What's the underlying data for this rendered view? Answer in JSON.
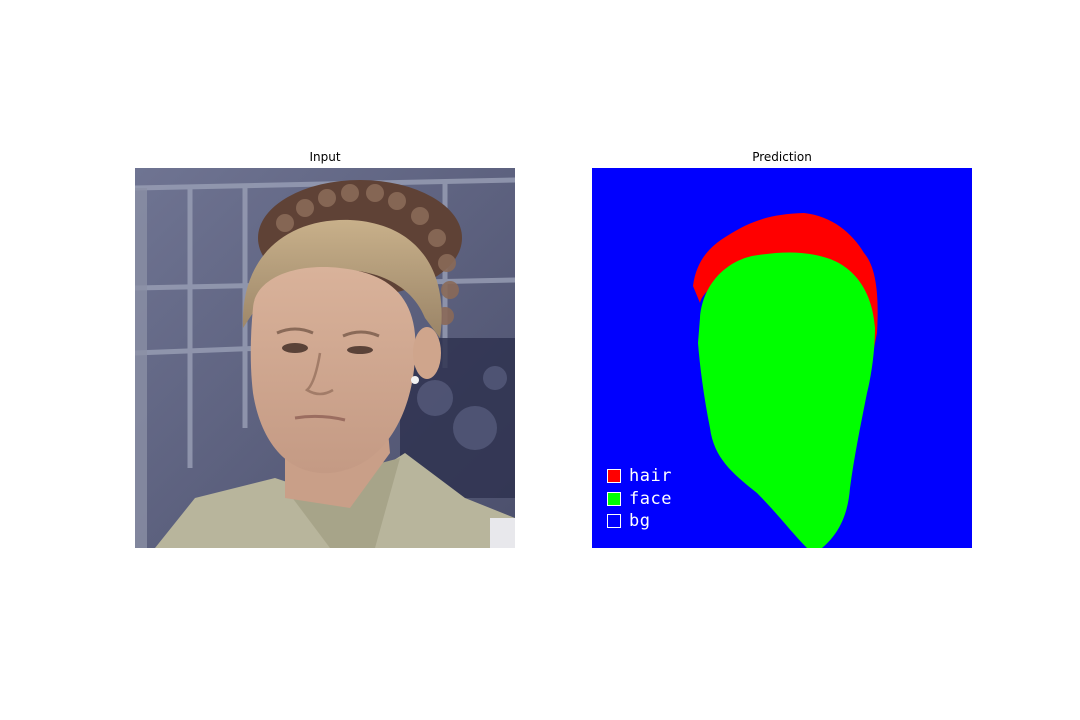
{
  "panels": {
    "input": {
      "title": "Input"
    },
    "prediction": {
      "title": "Prediction"
    }
  },
  "legend": [
    {
      "label": "hair",
      "color": "#ff0000"
    },
    {
      "label": "face",
      "color": "#00ff00"
    },
    {
      "label": "bg",
      "color": "#0000ff"
    }
  ],
  "colors": {
    "hair": "#ff0000",
    "face": "#00ff00",
    "bg": "#0000ff"
  }
}
